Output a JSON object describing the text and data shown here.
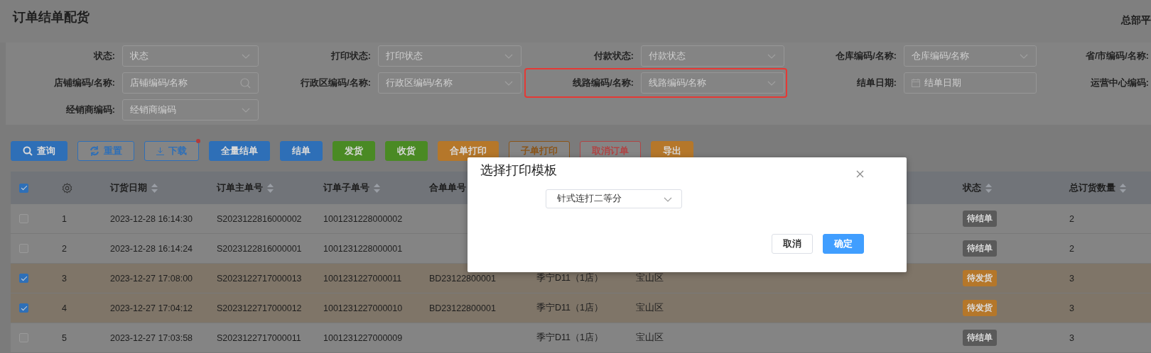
{
  "page_title": "订单结单配货",
  "user": "总部平",
  "filters": [
    {
      "label": "状态:",
      "placeholder": "状态",
      "kind": "select",
      "highlighted": false
    },
    {
      "label": "打印状态:",
      "placeholder": "打印状态",
      "kind": "select",
      "highlighted": false
    },
    {
      "label": "付款状态:",
      "placeholder": "付款状态",
      "kind": "select",
      "highlighted": false
    },
    {
      "label": "仓库编码/名称:",
      "placeholder": "仓库编码/名称",
      "kind": "select",
      "highlighted": false
    },
    {
      "label": "省/市编码/名称:",
      "kind": "cut",
      "highlighted": false
    },
    {
      "label": "店铺编码/名称:",
      "placeholder": "店铺编码/名称",
      "kind": "search",
      "highlighted": false
    },
    {
      "label": "行政区编码/名称:",
      "placeholder": "行政区编码/名称",
      "kind": "select",
      "highlighted": false
    },
    {
      "label": "线路编码/名称:",
      "placeholder": "线路编码/名称",
      "kind": "select",
      "highlighted": true
    },
    {
      "label": "结单日期:",
      "placeholder": "结单日期",
      "kind": "date",
      "highlighted": false
    },
    {
      "label": "运营中心编码:",
      "kind": "cut",
      "highlighted": false
    },
    {
      "label": "经销商编码:",
      "placeholder": "经销商编码",
      "kind": "select",
      "highlighted": false
    }
  ],
  "buttons": [
    {
      "label": "查询",
      "kind": "solid",
      "color": "#2e6fb7",
      "badge_dot": false
    },
    {
      "label": "重置",
      "kind": "outline",
      "color": "#2e6fb7",
      "badge_dot": false
    },
    {
      "label": "下载",
      "kind": "outline",
      "color": "#2e6fb7",
      "badge_dot": true
    },
    {
      "label": "全量结单",
      "kind": "solid",
      "color": "#2e6fb7",
      "badge_dot": false
    },
    {
      "label": "结单",
      "kind": "solid",
      "color": "#2e6fb7",
      "badge_dot": false
    },
    {
      "label": "发货",
      "kind": "solid",
      "color": "#4a8a24",
      "badge_dot": false
    },
    {
      "label": "收货",
      "kind": "solid",
      "color": "#4a8a24",
      "badge_dot": false
    },
    {
      "label": "合单打印",
      "kind": "solid",
      "color": "#b5772a",
      "badge_dot": false
    },
    {
      "label": "子单打印",
      "kind": "outline",
      "color": "#8a5418",
      "badge_dot": false
    },
    {
      "label": "取消订单",
      "kind": "outline",
      "color": "#b04444",
      "badge_dot": false
    },
    {
      "label": "导出",
      "kind": "solid",
      "color": "#b5772a",
      "badge_dot": false
    }
  ],
  "table": {
    "all_checked": true,
    "columns": [
      {
        "label": "订货日期",
        "sortable": true
      },
      {
        "label": "订单主单号",
        "sortable": true
      },
      {
        "label": "订单子单号",
        "sortable": true
      },
      {
        "label": "合单单号",
        "sortable": false
      },
      {
        "label": "状态",
        "sortable": true
      },
      {
        "label": "总订货数量",
        "sortable": true
      }
    ],
    "rows": [
      {
        "selected": false,
        "no": "1",
        "date": "2023-12-28 16:14:30",
        "main_no": "S2023122816000002",
        "sub_no": "1001231228000002",
        "status": {
          "text": "待结单",
          "color": "#5a5a5a"
        },
        "total": "2"
      },
      {
        "selected": false,
        "no": "2",
        "date": "2023-12-28 16:14:24",
        "main_no": "S2023122816000001",
        "sub_no": "1001231228000001",
        "status": {
          "text": "待结单",
          "color": "#5a5a5a"
        },
        "total": "2"
      },
      {
        "selected": true,
        "no": "3",
        "date": "2023-12-27 17:08:00",
        "main_no": "S2023122717000013",
        "sub_no": "1001231227000011",
        "merged_no": "BD23122800001",
        "column_5": "季宁D11（1店）",
        "column_6": "宝山区",
        "status": {
          "text": "待发货",
          "color": "#b5772a"
        },
        "total": "3"
      },
      {
        "selected": true,
        "no": "4",
        "date": "2023-12-27 17:04:12",
        "main_no": "S2023122717000012",
        "sub_no": "1001231227000010",
        "merged_no": "BD23122800001",
        "column_5": "季宁D11（1店）",
        "column_6": "宝山区",
        "status": {
          "text": "待发货",
          "color": "#b5772a"
        },
        "total": "3"
      },
      {
        "selected": false,
        "no": "5",
        "date": "2023-12-27 17:03:58",
        "main_no": "S2023122717000011",
        "sub_no": "1001231227000009",
        "column_5": "季宁D11（1店）",
        "column_6": "宝山区",
        "status": {
          "text": "待结单",
          "color": "#5a5a5a"
        },
        "total": "3"
      }
    ]
  },
  "modal": {
    "title": "选择打印模板",
    "select_value": "针式连打二等分",
    "buttons": [
      {
        "label": "取消",
        "kind": "plain"
      },
      {
        "label": "确定",
        "kind": "primary"
      }
    ]
  }
}
